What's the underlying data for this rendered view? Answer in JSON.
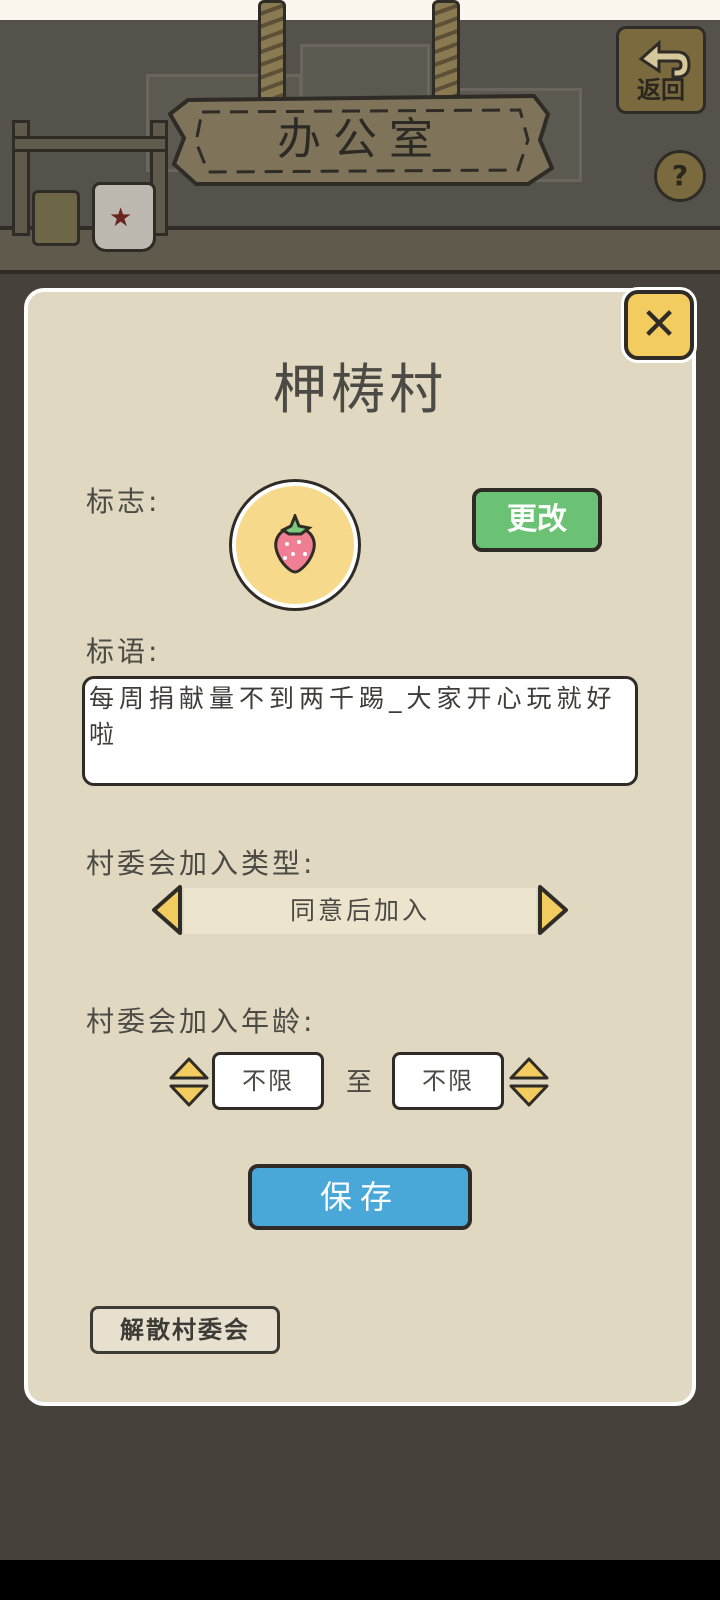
{
  "header": {
    "sign_title": "办公室",
    "back_label": "返回",
    "help_label": "?"
  },
  "dialog": {
    "title": "柙梼村",
    "close_label": "✕",
    "logo": {
      "label": "标志:",
      "icon": "strawberry-icon",
      "change_button": "更改"
    },
    "slogan": {
      "label": "标语:",
      "text": "每周捐献量不到两千踢_大家开心玩就好啦"
    },
    "join_type": {
      "label": "村委会加入类型:",
      "value": "同意后加入"
    },
    "join_age": {
      "label": "村委会加入年龄:",
      "min": "不限",
      "to": "至",
      "max": "不限"
    },
    "save_button": "保存",
    "disband_button": "解散村委会"
  },
  "colors": {
    "panel": "#e0d8c0",
    "accent_green": "#6bc275",
    "accent_blue": "#4aa8d8",
    "accent_yellow": "#f3cc5f"
  }
}
